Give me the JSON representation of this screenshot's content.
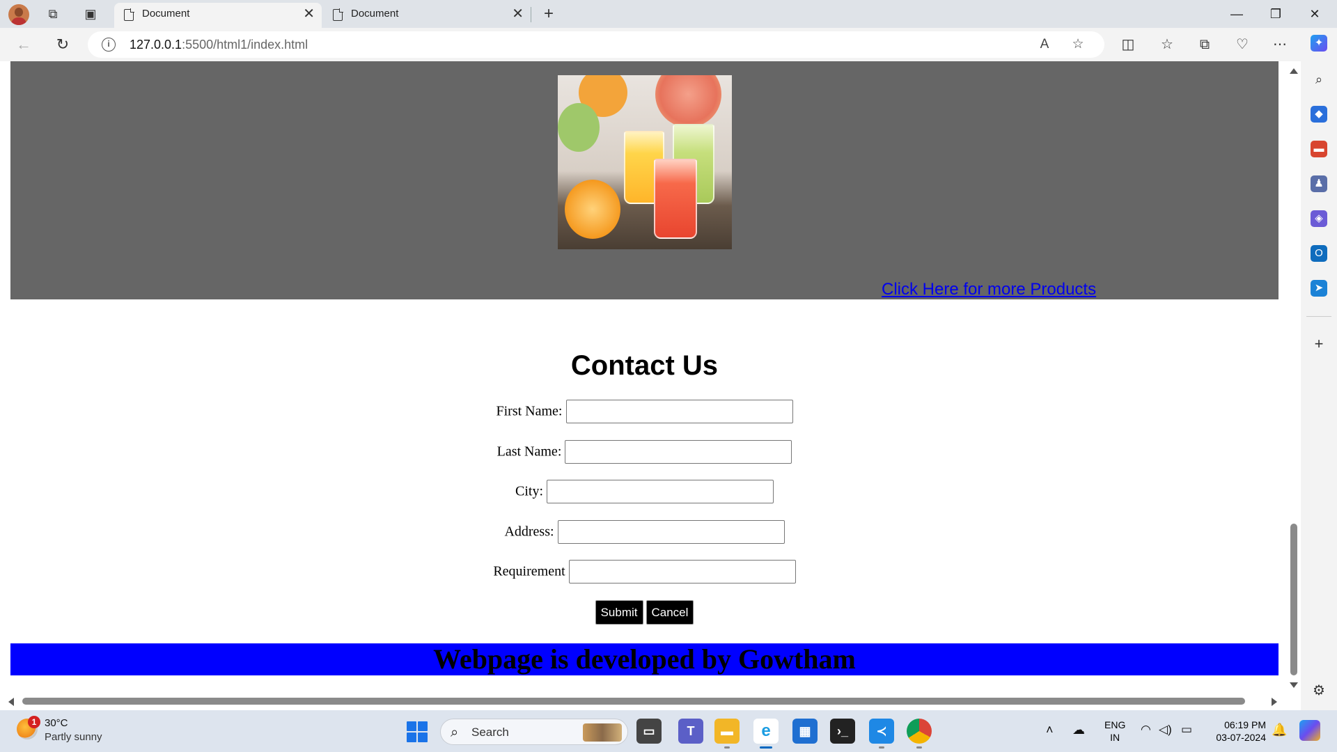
{
  "browser": {
    "tabs": [
      {
        "title": "Document",
        "active": true
      },
      {
        "title": "Document",
        "active": false
      }
    ],
    "new_tab_symbol": "+",
    "window_controls": {
      "minimize": "—",
      "restore": "❐",
      "close": "✕"
    },
    "address": {
      "host": "127.0.0.1",
      "rest": ":5500/html1/index.html"
    }
  },
  "page": {
    "hero_link": "Click Here for more Products",
    "contact_title": "Contact Us",
    "form": {
      "fields": [
        {
          "label": "First Name:",
          "value": ""
        },
        {
          "label": "Last Name:",
          "value": ""
        },
        {
          "label": "City:",
          "value": ""
        },
        {
          "label": "Address:",
          "value": ""
        },
        {
          "label": "Requirement",
          "value": ""
        }
      ],
      "submit_label": "Submit",
      "cancel_label": "Cancel"
    },
    "footer": "Webpage is developed by Gowtham",
    "colors": {
      "hero_bg": "#666666",
      "footer_bg": "#0000ff",
      "link": "#0000ee"
    }
  },
  "taskbar": {
    "weather": {
      "badge": "1",
      "temp": "30°C",
      "desc": "Partly sunny"
    },
    "search_placeholder": "Search",
    "lang": {
      "line1": "ENG",
      "line2": "IN"
    },
    "clock": {
      "time": "06:19 PM",
      "date": "03-07-2024"
    }
  },
  "icons": {
    "sidebar": [
      "search-icon",
      "shopping-tag-icon",
      "tools-icon",
      "games-icon",
      "copilot-icon",
      "outlook-icon",
      "send-icon",
      "add-icon",
      "settings-icon"
    ]
  }
}
